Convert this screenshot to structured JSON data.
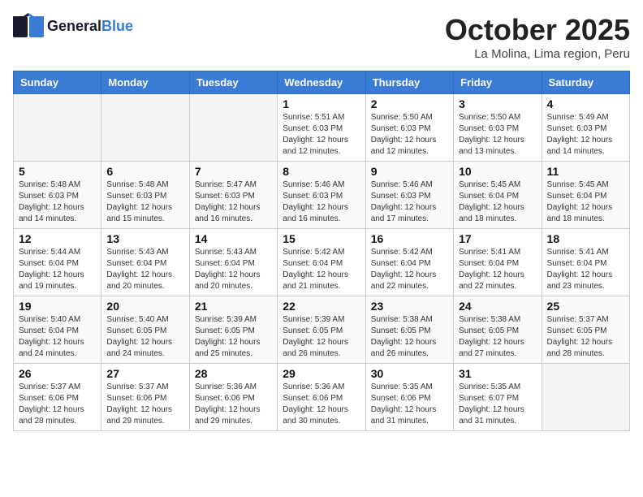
{
  "header": {
    "logo_general": "General",
    "logo_blue": "Blue",
    "month_title": "October 2025",
    "location": "La Molina, Lima region, Peru"
  },
  "weekdays": [
    "Sunday",
    "Monday",
    "Tuesday",
    "Wednesday",
    "Thursday",
    "Friday",
    "Saturday"
  ],
  "weeks": [
    [
      {
        "day": "",
        "empty": true
      },
      {
        "day": "",
        "empty": true
      },
      {
        "day": "",
        "empty": true
      },
      {
        "day": "1",
        "sunrise": "5:51 AM",
        "sunset": "6:03 PM",
        "daylight": "12 hours and 12 minutes."
      },
      {
        "day": "2",
        "sunrise": "5:50 AM",
        "sunset": "6:03 PM",
        "daylight": "12 hours and 12 minutes."
      },
      {
        "day": "3",
        "sunrise": "5:50 AM",
        "sunset": "6:03 PM",
        "daylight": "12 hours and 13 minutes."
      },
      {
        "day": "4",
        "sunrise": "5:49 AM",
        "sunset": "6:03 PM",
        "daylight": "12 hours and 14 minutes."
      }
    ],
    [
      {
        "day": "5",
        "sunrise": "5:48 AM",
        "sunset": "6:03 PM",
        "daylight": "12 hours and 14 minutes."
      },
      {
        "day": "6",
        "sunrise": "5:48 AM",
        "sunset": "6:03 PM",
        "daylight": "12 hours and 15 minutes."
      },
      {
        "day": "7",
        "sunrise": "5:47 AM",
        "sunset": "6:03 PM",
        "daylight": "12 hours and 16 minutes."
      },
      {
        "day": "8",
        "sunrise": "5:46 AM",
        "sunset": "6:03 PM",
        "daylight": "12 hours and 16 minutes."
      },
      {
        "day": "9",
        "sunrise": "5:46 AM",
        "sunset": "6:03 PM",
        "daylight": "12 hours and 17 minutes."
      },
      {
        "day": "10",
        "sunrise": "5:45 AM",
        "sunset": "6:04 PM",
        "daylight": "12 hours and 18 minutes."
      },
      {
        "day": "11",
        "sunrise": "5:45 AM",
        "sunset": "6:04 PM",
        "daylight": "12 hours and 18 minutes."
      }
    ],
    [
      {
        "day": "12",
        "sunrise": "5:44 AM",
        "sunset": "6:04 PM",
        "daylight": "12 hours and 19 minutes."
      },
      {
        "day": "13",
        "sunrise": "5:43 AM",
        "sunset": "6:04 PM",
        "daylight": "12 hours and 20 minutes."
      },
      {
        "day": "14",
        "sunrise": "5:43 AM",
        "sunset": "6:04 PM",
        "daylight": "12 hours and 20 minutes."
      },
      {
        "day": "15",
        "sunrise": "5:42 AM",
        "sunset": "6:04 PM",
        "daylight": "12 hours and 21 minutes."
      },
      {
        "day": "16",
        "sunrise": "5:42 AM",
        "sunset": "6:04 PM",
        "daylight": "12 hours and 22 minutes."
      },
      {
        "day": "17",
        "sunrise": "5:41 AM",
        "sunset": "6:04 PM",
        "daylight": "12 hours and 22 minutes."
      },
      {
        "day": "18",
        "sunrise": "5:41 AM",
        "sunset": "6:04 PM",
        "daylight": "12 hours and 23 minutes."
      }
    ],
    [
      {
        "day": "19",
        "sunrise": "5:40 AM",
        "sunset": "6:04 PM",
        "daylight": "12 hours and 24 minutes."
      },
      {
        "day": "20",
        "sunrise": "5:40 AM",
        "sunset": "6:05 PM",
        "daylight": "12 hours and 24 minutes."
      },
      {
        "day": "21",
        "sunrise": "5:39 AM",
        "sunset": "6:05 PM",
        "daylight": "12 hours and 25 minutes."
      },
      {
        "day": "22",
        "sunrise": "5:39 AM",
        "sunset": "6:05 PM",
        "daylight": "12 hours and 26 minutes."
      },
      {
        "day": "23",
        "sunrise": "5:38 AM",
        "sunset": "6:05 PM",
        "daylight": "12 hours and 26 minutes."
      },
      {
        "day": "24",
        "sunrise": "5:38 AM",
        "sunset": "6:05 PM",
        "daylight": "12 hours and 27 minutes."
      },
      {
        "day": "25",
        "sunrise": "5:37 AM",
        "sunset": "6:05 PM",
        "daylight": "12 hours and 28 minutes."
      }
    ],
    [
      {
        "day": "26",
        "sunrise": "5:37 AM",
        "sunset": "6:06 PM",
        "daylight": "12 hours and 28 minutes."
      },
      {
        "day": "27",
        "sunrise": "5:37 AM",
        "sunset": "6:06 PM",
        "daylight": "12 hours and 29 minutes."
      },
      {
        "day": "28",
        "sunrise": "5:36 AM",
        "sunset": "6:06 PM",
        "daylight": "12 hours and 29 minutes."
      },
      {
        "day": "29",
        "sunrise": "5:36 AM",
        "sunset": "6:06 PM",
        "daylight": "12 hours and 30 minutes."
      },
      {
        "day": "30",
        "sunrise": "5:35 AM",
        "sunset": "6:06 PM",
        "daylight": "12 hours and 31 minutes."
      },
      {
        "day": "31",
        "sunrise": "5:35 AM",
        "sunset": "6:07 PM",
        "daylight": "12 hours and 31 minutes."
      },
      {
        "day": "",
        "empty": true
      }
    ]
  ],
  "labels": {
    "sunrise": "Sunrise:",
    "sunset": "Sunset:",
    "daylight": "Daylight hours"
  }
}
